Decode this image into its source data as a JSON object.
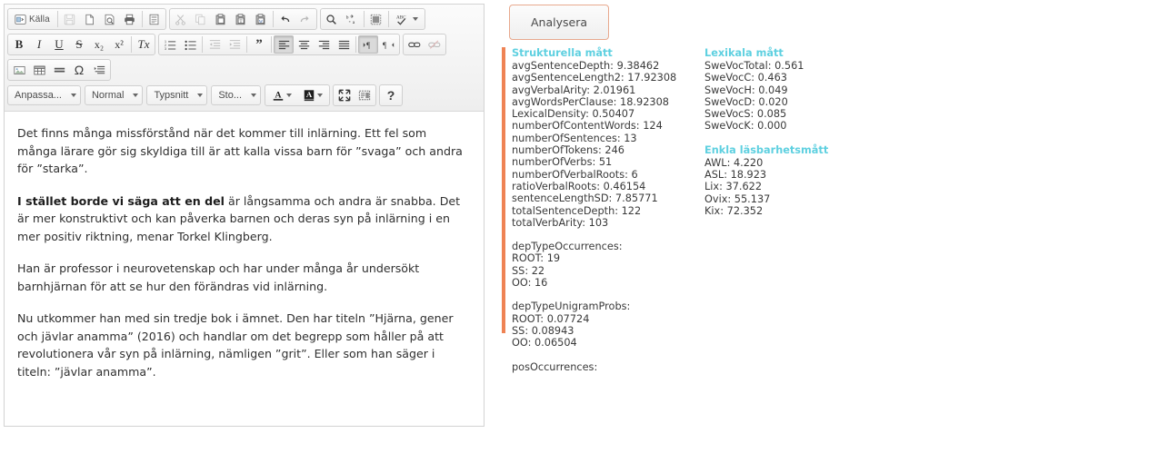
{
  "editor": {
    "toolbar": {
      "row1": [
        {
          "group": [
            {
              "name": "source-button",
              "label": "Källa",
              "icon": "source-icon",
              "wide": true,
              "state": "normal"
            },
            {
              "name": "sep",
              "icon": "separator"
            },
            {
              "name": "save-button",
              "label": "",
              "icon": "save-icon",
              "state": "disabled"
            },
            {
              "name": "new-page-button",
              "label": "",
              "icon": "new-page-icon",
              "state": "normal"
            },
            {
              "name": "preview-button",
              "label": "",
              "icon": "preview-icon",
              "state": "normal"
            },
            {
              "name": "print-button",
              "label": "",
              "icon": "print-icon",
              "state": "normal"
            },
            {
              "name": "sep",
              "icon": "separator"
            },
            {
              "name": "templates-button",
              "label": "",
              "icon": "templates-icon",
              "state": "normal"
            }
          ]
        },
        {
          "group": [
            {
              "name": "cut-button",
              "label": "",
              "icon": "scissors-icon",
              "state": "disabled"
            },
            {
              "name": "copy-button",
              "label": "",
              "icon": "copy-icon",
              "state": "disabled"
            },
            {
              "name": "paste-button",
              "label": "",
              "icon": "paste-icon",
              "state": "normal"
            },
            {
              "name": "paste-text-button",
              "label": "",
              "icon": "paste-text-icon",
              "state": "normal"
            },
            {
              "name": "paste-word-button",
              "label": "",
              "icon": "paste-word-icon",
              "state": "normal"
            },
            {
              "name": "sep",
              "icon": "separator"
            },
            {
              "name": "undo-button",
              "label": "",
              "icon": "undo-icon",
              "state": "normal"
            },
            {
              "name": "redo-button",
              "label": "",
              "icon": "redo-icon",
              "state": "disabled"
            }
          ]
        },
        {
          "group": [
            {
              "name": "find-button",
              "label": "",
              "icon": "search-icon",
              "state": "normal"
            },
            {
              "name": "replace-button",
              "label": "",
              "icon": "replace-icon",
              "state": "normal"
            },
            {
              "name": "sep",
              "icon": "separator"
            },
            {
              "name": "select-all-button",
              "label": "",
              "icon": "select-all-icon",
              "state": "normal"
            },
            {
              "name": "sep",
              "icon": "separator"
            },
            {
              "name": "spellcheck-button",
              "label": "",
              "icon": "spellcheck-icon",
              "state": "normal"
            }
          ]
        }
      ],
      "row2": [
        {
          "group": [
            {
              "name": "bold-button",
              "label": "B",
              "icon": "bold-icon",
              "state": "normal"
            },
            {
              "name": "italic-button",
              "label": "I",
              "icon": "italic-icon",
              "state": "normal"
            },
            {
              "name": "underline-button",
              "label": "U",
              "icon": "underline-icon",
              "state": "normal"
            },
            {
              "name": "strike-button",
              "label": "S",
              "icon": "strikethrough-icon",
              "state": "normal"
            },
            {
              "name": "subscript-button",
              "label": "x₂",
              "icon": "subscript-icon",
              "state": "normal"
            },
            {
              "name": "superscript-button",
              "label": "x²",
              "icon": "superscript-icon",
              "state": "normal"
            },
            {
              "name": "sep",
              "icon": "separator"
            },
            {
              "name": "remove-format-button",
              "label": "Tx",
              "icon": "remove-format-icon",
              "state": "normal"
            }
          ]
        },
        {
          "group": [
            {
              "name": "numbered-list-button",
              "label": "",
              "icon": "numbered-list-icon",
              "state": "normal"
            },
            {
              "name": "bulleted-list-button",
              "label": "",
              "icon": "bulleted-list-icon",
              "state": "normal"
            },
            {
              "name": "sep",
              "icon": "separator"
            },
            {
              "name": "outdent-button",
              "label": "",
              "icon": "outdent-icon",
              "state": "disabled"
            },
            {
              "name": "indent-button",
              "label": "",
              "icon": "indent-icon",
              "state": "disabled"
            },
            {
              "name": "sep",
              "icon": "separator"
            },
            {
              "name": "blockquote-button",
              "label": "",
              "icon": "blockquote-icon",
              "state": "normal"
            },
            {
              "name": "sep",
              "icon": "separator"
            },
            {
              "name": "align-left-button",
              "label": "",
              "icon": "align-left-icon",
              "state": "active"
            },
            {
              "name": "align-center-button",
              "label": "",
              "icon": "align-center-icon",
              "state": "normal"
            },
            {
              "name": "align-right-button",
              "label": "",
              "icon": "align-right-icon",
              "state": "normal"
            },
            {
              "name": "align-justify-button",
              "label": "",
              "icon": "align-justify-icon",
              "state": "normal"
            },
            {
              "name": "sep",
              "icon": "separator"
            },
            {
              "name": "ltr-button",
              "label": "",
              "icon": "text-direction-ltr-icon",
              "state": "active"
            },
            {
              "name": "rtl-button",
              "label": "",
              "icon": "text-direction-rtl-icon",
              "state": "normal"
            }
          ]
        },
        {
          "group": [
            {
              "name": "link-button",
              "label": "",
              "icon": "link-icon",
              "state": "normal"
            },
            {
              "name": "unlink-button",
              "label": "",
              "icon": "unlink-icon",
              "state": "disabled"
            }
          ]
        }
      ],
      "row3": [
        {
          "group": [
            {
              "name": "image-button",
              "label": "",
              "icon": "image-icon",
              "state": "normal"
            },
            {
              "name": "table-button",
              "label": "",
              "icon": "table-icon",
              "state": "normal"
            },
            {
              "name": "horizontal-rule-button",
              "label": "",
              "icon": "horizontal-rule-icon",
              "state": "normal"
            },
            {
              "name": "special-char-button",
              "label": "Ω",
              "icon": "omega-icon",
              "state": "normal"
            },
            {
              "name": "page-break-button",
              "label": "",
              "icon": "page-break-icon",
              "state": "normal"
            }
          ]
        }
      ],
      "combos": [
        {
          "name": "styles-combo",
          "value": "Anpassa..."
        },
        {
          "name": "format-combo",
          "value": "Normal"
        },
        {
          "name": "font-combo",
          "value": "Typsnitt"
        },
        {
          "name": "size-combo",
          "value": "Sto..."
        }
      ],
      "row4_buttons": [
        {
          "name": "text-color-button",
          "label": "A",
          "icon": "text-color-icon"
        },
        {
          "name": "background-color-button",
          "label": "A",
          "icon": "background-color-icon"
        },
        {
          "name": "maximize-button",
          "label": "",
          "icon": "maximize-icon"
        },
        {
          "name": "show-blocks-button",
          "label": "",
          "icon": "show-blocks-icon"
        },
        {
          "name": "about-button",
          "label": "?",
          "icon": "help-icon"
        }
      ]
    },
    "document": {
      "paragraphs": [
        {
          "type": "plain",
          "text": "Det finns många missförstånd när det kommer till inlärning. Ett fel som många lärare gör sig skyldiga till är att kalla vissa barn för ”svaga” och andra för ”starka”."
        },
        {
          "type": "lead",
          "bold": "I stället borde vi säga att en del",
          "text": " är långsamma och andra är snabba. Det är mer konstruktivt och kan påverka barnen och deras syn på inlärning i en mer positiv riktning, menar Torkel Klingberg."
        },
        {
          "type": "plain",
          "text": "Han är professor i neurovetenskap och har under många år undersökt barnhjärnan för att se hur den förändras vid inlärning."
        },
        {
          "type": "plain",
          "text": "Nu utkommer han med sin tredje bok i ämnet. Den har titeln ”Hjärna, gener och jävlar anamma” (2016) och handlar om det begrepp som håller på att revolutionera vår syn på inlärning, nämligen ”grit”. Eller som han säger i titeln: ”jävlar anamma”."
        }
      ]
    }
  },
  "panel": {
    "analyze_button_label": "Analysera",
    "accent_color": "#ef8354",
    "heading_color": "#5ed0e0",
    "left_column": [
      {
        "name": "structural-metrics-section",
        "title": "Strukturella mått",
        "metrics": [
          "avgSentenceDepth: 9.38462",
          "avgSentenceLength2: 17.92308",
          "avgVerbalArity: 2.01961",
          "avgWordsPerClause: 18.92308",
          "LexicalDensity: 0.50407",
          "numberOfContentWords: 124",
          "numberOfSentences: 13",
          "numberOfTokens: 246",
          "numberOfVerbs: 51",
          "numberOfVerbalRoots: 6",
          "ratioVerbalRoots: 0.46154",
          "sentenceLengthSD: 7.85771",
          "totalSentenceDepth: 122",
          "totalVerbArity: 103"
        ]
      },
      {
        "name": "dep-type-occurrences-section",
        "title": "",
        "metrics": [
          "depTypeOccurrences:",
          "ROOT: 19",
          "SS: 22",
          "OO: 16"
        ]
      },
      {
        "name": "dep-type-unigram-probs-section",
        "title": "",
        "metrics": [
          "depTypeUnigramProbs:",
          "ROOT: 0.07724",
          "SS: 0.08943",
          "OO: 0.06504"
        ]
      },
      {
        "name": "pos-occurrences-section",
        "title": "",
        "metrics": [
          "posOccurrences:"
        ]
      }
    ],
    "right_column": [
      {
        "name": "lexical-metrics-section",
        "title": "Lexikala mått",
        "metrics": [
          "SweVocTotal: 0.561",
          "SweVocC: 0.463",
          "SweVocH: 0.049",
          "SweVocD: 0.020",
          "SweVocS: 0.085",
          "SweVocK: 0.000"
        ]
      },
      {
        "name": "readability-metrics-section",
        "title": "Enkla läsbarhetsmått",
        "metrics": [
          "AWL: 4.220",
          "ASL: 18.923",
          "Lix: 37.622",
          "Ovix: 55.137",
          "Kix: 72.352"
        ]
      }
    ]
  }
}
